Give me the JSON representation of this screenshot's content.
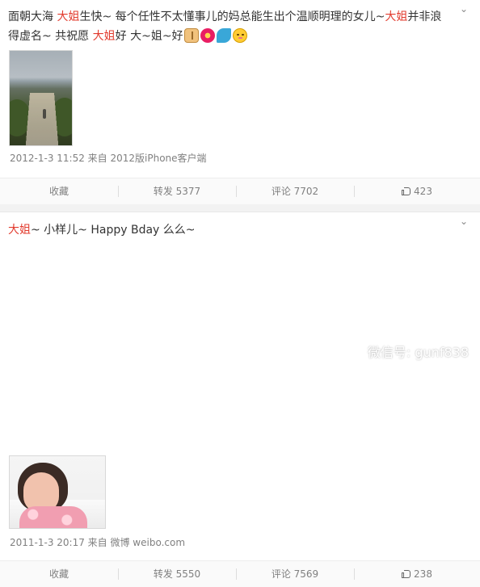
{
  "posts": [
    {
      "text_parts": [
        "面朝大海 ",
        "大姐",
        "生快~ 每个任性不太懂事儿的妈总能生出个温顺明理的女儿~",
        "大姐",
        "并非浪得虚名~ 共祝愿 ",
        "大姐",
        "好 大~姐~好"
      ],
      "emoji_icons": [
        "folded-hands-icon",
        "hibiscus-icon",
        "dolphin-icon",
        "blushing-face-icon"
      ],
      "meta": "2012-1-3 11:52 来自 2012版iPhone客户端",
      "actions": {
        "collect": "收藏",
        "repost": "转发 5377",
        "comment": "评论 7702",
        "like": "423"
      }
    },
    {
      "text_parts": [
        "大姐",
        "~ 小样儿~ Happy Bday 么么~"
      ],
      "meta": "2011-1-3 20:17 来自 微博 weibo.com",
      "actions": {
        "collect": "收藏",
        "repost": "转发 5550",
        "comment": "评论 7569",
        "like": "238"
      }
    }
  ],
  "watermark": {
    "text": "微信号: gunf838"
  },
  "colors": {
    "highlight": "#e23b2e",
    "meta": "#808080",
    "separator": "#e8e8e8"
  }
}
